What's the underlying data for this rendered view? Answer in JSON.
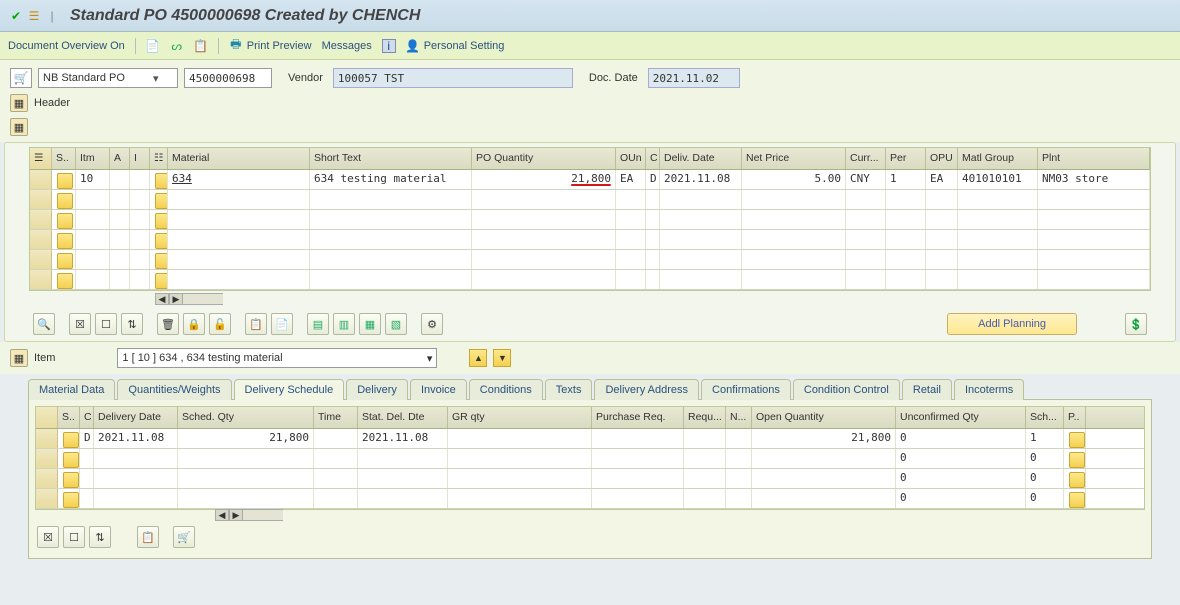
{
  "title": "Standard PO 4500000698 Created by CHENCH",
  "toolbar": {
    "doc_overview": "Document Overview On",
    "print_preview": "Print Preview",
    "messages": "Messages",
    "personal_setting": "Personal Setting"
  },
  "header": {
    "po_type": "NB Standard PO",
    "po_number": "4500000698",
    "vendor_label": "Vendor",
    "vendor_value": "100057 TST",
    "doc_date_label": "Doc. Date",
    "doc_date_value": "2021.11.02",
    "header_toggle": "Header"
  },
  "items_cols": {
    "s": "S..",
    "itm": "Itm",
    "a": "A",
    "i": "I",
    "material": "Material",
    "short_text": "Short Text",
    "po_qty": "PO Quantity",
    "oun": "OUn",
    "c": "C",
    "deliv_date": "Deliv. Date",
    "net_price": "Net Price",
    "curr": "Curr...",
    "per": "Per",
    "opu": "OPU",
    "matl_group": "Matl Group",
    "plnt": "Plnt"
  },
  "items": [
    {
      "itm": "10",
      "material": "634",
      "short_text": "634 testing material",
      "po_qty": "21,800",
      "oun": "EA",
      "c": "D",
      "deliv_date": "2021.11.08",
      "net_price": "5.00",
      "curr": "CNY",
      "per": "1",
      "opu": "EA",
      "matl_group": "401010101",
      "plnt": "NM03 store"
    }
  ],
  "addl_planning": "Addl Planning",
  "item_detail": {
    "label": "Item",
    "value": "1 [ 10 ] 634 , 634 testing material"
  },
  "tabs": [
    "Material Data",
    "Quantities/Weights",
    "Delivery Schedule",
    "Delivery",
    "Invoice",
    "Conditions",
    "Texts",
    "Delivery Address",
    "Confirmations",
    "Condition Control",
    "Retail",
    "Incoterms"
  ],
  "active_tab": 2,
  "sched_cols": {
    "s": "S..",
    "c": "C",
    "delivery_date": "Delivery Date",
    "sched_qty": "Sched. Qty",
    "time": "Time",
    "stat_del_dte": "Stat. Del. Dte",
    "gr_qty": "GR qty",
    "purchase_req": "Purchase Req.",
    "requ": "Requ...",
    "n": "N...",
    "open_qty": "Open Quantity",
    "unconf_qty": "Unconfirmed Qty",
    "sch": "Sch...",
    "p": "P.."
  },
  "sched_rows": [
    {
      "c": "D",
      "delivery_date": "2021.11.08",
      "sched_qty": "21,800",
      "time": "",
      "stat_del_dte": "2021.11.08",
      "gr_qty": "",
      "purchase_req": "",
      "requ": "",
      "n": "",
      "open_qty": "21,800",
      "unconf_qty": "0",
      "sch": "1",
      "p": ""
    },
    {
      "c": "",
      "delivery_date": "",
      "sched_qty": "",
      "time": "",
      "stat_del_dte": "",
      "gr_qty": "",
      "purchase_req": "",
      "requ": "",
      "n": "",
      "open_qty": "",
      "unconf_qty": "0",
      "sch": "0",
      "p": ""
    },
    {
      "c": "",
      "delivery_date": "",
      "sched_qty": "",
      "time": "",
      "stat_del_dte": "",
      "gr_qty": "",
      "purchase_req": "",
      "requ": "",
      "n": "",
      "open_qty": "",
      "unconf_qty": "0",
      "sch": "0",
      "p": ""
    },
    {
      "c": "",
      "delivery_date": "",
      "sched_qty": "",
      "time": "",
      "stat_del_dte": "",
      "gr_qty": "",
      "purchase_req": "",
      "requ": "",
      "n": "",
      "open_qty": "",
      "unconf_qty": "0",
      "sch": "0",
      "p": ""
    }
  ]
}
